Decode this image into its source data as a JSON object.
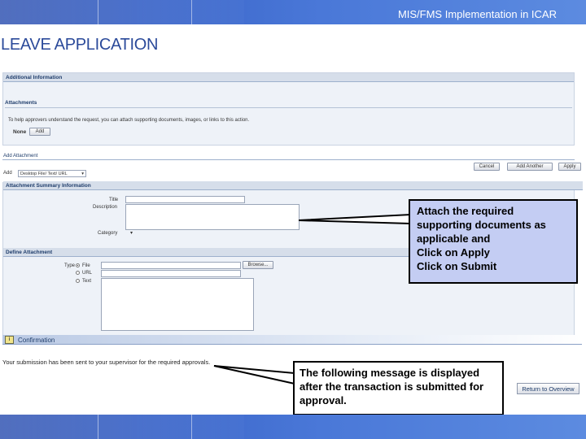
{
  "header": {
    "title": "MIS/FMS Implementation in ICAR"
  },
  "page": {
    "heading": "LEAVE APPLICATION"
  },
  "additional_info": {
    "section_title": "Additional Information",
    "attachments_title": "Attachments",
    "help_text": "To help approvers understand the request, you can attach supporting documents, images, or links to this action.",
    "none_label": "None",
    "add_button": "Add"
  },
  "add_attachment": {
    "title": "Add Attachment",
    "add_label": "Add",
    "add_select_value": "Desktop File/ Text/ URL",
    "cancel_button": "Cancel",
    "add_another_button": "Add Another",
    "apply_button": "Apply"
  },
  "summary": {
    "section_title": "Attachment Summary Information",
    "title_label": "Title",
    "description_label": "Description",
    "category_label": "Category"
  },
  "define": {
    "section_title": "Define Attachment",
    "type_label": "Type",
    "file_option": "File",
    "url_option": "URL",
    "text_option": "Text",
    "browse_button": "Browse..."
  },
  "confirmation": {
    "title": "Confirmation",
    "message": "Your submission has been sent to your supervisor for the required approvals.",
    "return_button": "Return to Overview"
  },
  "callouts": {
    "attach": {
      "line1": "Attach the required",
      "line2": "supporting documents as",
      "line3": "applicable and",
      "line4": "Click on Apply",
      "line5": "Click on Submit"
    },
    "message": {
      "line1": "The following message is displayed",
      "line2": "after the transaction is submitted for",
      "line3": "approval."
    }
  },
  "colors": {
    "banner": "#3a64c8",
    "heading": "#2b4a9a",
    "callout_fill": "#c4cdf3",
    "section_header": "#d6deea"
  },
  "icons": {
    "notice": "info-notice-icon",
    "dropdown": "chevron-down-icon"
  }
}
